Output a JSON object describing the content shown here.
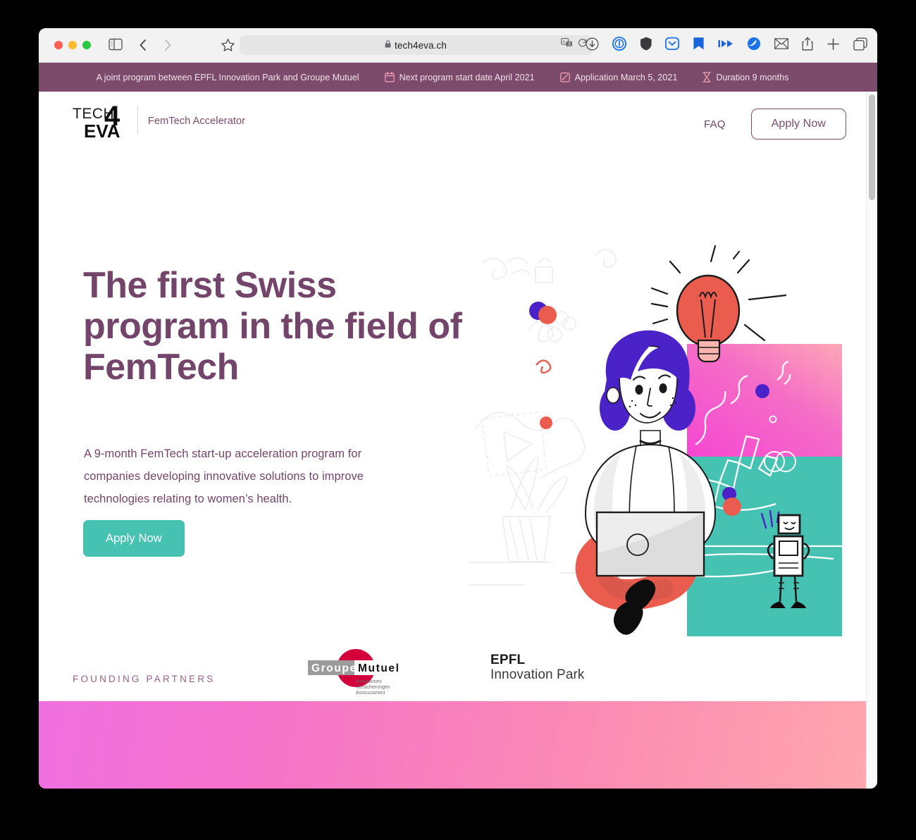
{
  "browser": {
    "url": "tech4eva.ch",
    "lock_icon": "lock-icon",
    "traffic_lights": [
      "close-button",
      "minimize-button",
      "maximize-button"
    ],
    "toolbar_icons": [
      "sidebar-toggle-icon",
      "back-arrow-icon",
      "forward-arrow-icon",
      "star-bookmark-icon",
      "translate-icon",
      "reload-icon",
      "downloads-icon",
      "onepassword-icon",
      "shield-privacy-icon",
      "pocket-icon",
      "bookmark-flag-icon",
      "fastforward-icon",
      "globe-browser-icon",
      "mail-icon",
      "share-icon",
      "new-tab-icon",
      "tab-overview-icon"
    ]
  },
  "announce": {
    "items": [
      {
        "icon": "",
        "text": "A joint program between EPFL Innovation Park and Groupe Mutuel"
      },
      {
        "icon": "calendar-icon",
        "text": "Next program start date April 2021"
      },
      {
        "icon": "pencil-edit-icon",
        "text": "Application March 5, 2021"
      },
      {
        "icon": "hourglass-icon",
        "text": "Duration 9 months"
      }
    ],
    "bg_color": "#7c4a6b"
  },
  "nav": {
    "logo": {
      "top": "TECH",
      "four": "4",
      "bottom": "EVA"
    },
    "tagline": "FemTech Accelerator",
    "faq_label": "FAQ",
    "apply_label": "Apply Now"
  },
  "hero": {
    "heading": "The first Swiss program in the field of FemTech",
    "paragraph": "A 9-month FemTech start-up acceleration program for companies developing innovative solutions to improve technologies relating to women’s health.",
    "cta_label": "Apply Now",
    "cta_color": "#45c2b1",
    "heading_color": "#74456a",
    "illustration": {
      "name": "woman-with-laptop-illustration",
      "pink_block_color": "#f45fd0",
      "teal_block_color": "#45c2b1",
      "hair_color": "#4b22c8",
      "bulb_color": "#ea5c4e",
      "robot": "robot-icon"
    }
  },
  "partners": {
    "label": "FOUNDING PARTNERS",
    "label_color": "#9a5f86",
    "logos": [
      {
        "name": "groupe-mutuel-logo",
        "word1": "Groupe",
        "word2": "Mutuel",
        "lines": [
          "Assurances",
          "Versicherungen",
          "Assicurazioni"
        ],
        "accent": "#d4003c"
      },
      {
        "name": "epfl-innovation-park-logo",
        "line1": "EPFL",
        "line2": "Innovation Park"
      }
    ]
  },
  "footer_band": {
    "from": "#ef6fe0",
    "to": "#ffa7ae"
  }
}
